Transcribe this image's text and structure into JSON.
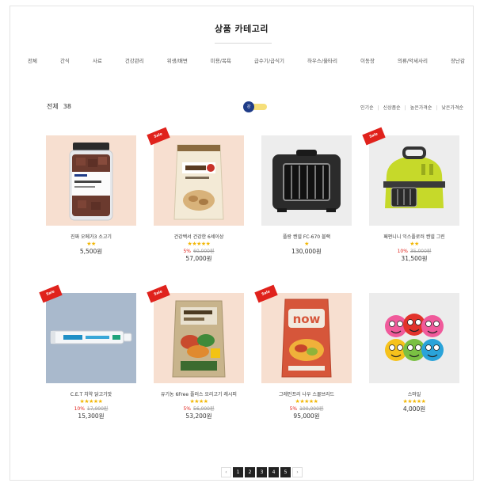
{
  "header": {
    "title": "상품 카테고리"
  },
  "categories": [
    "전체",
    "간식",
    "사료",
    "건강관리",
    "위생/배변",
    "미용/목욕",
    "급수기/급식기",
    "하우스/울타리",
    "이동장",
    "의류/악세사리",
    "장난감"
  ],
  "summary": {
    "label": "전체",
    "count": "38"
  },
  "toggle": {
    "label": "강"
  },
  "sort_options": [
    "인기순",
    "신상품순",
    "높은가격순",
    "낮은가격순"
  ],
  "sale_badge": "Sale",
  "products": [
    {
      "name": "진짜 오메가3 소고기",
      "stars": "★★",
      "discount": "",
      "original": "",
      "price": "5,500원"
    },
    {
      "name": "건강백서 건강한 6세이상",
      "stars": "★★★★★",
      "discount": "5%",
      "original": "60,000원",
      "price": "57,000원"
    },
    {
      "name": "플랑 켄넬 FC-670 블랙",
      "stars": "★",
      "discount": "",
      "original": "",
      "price": "130,000원"
    },
    {
      "name": "페펀니니 익스플로러 켄넬 그린",
      "stars": "★★",
      "discount": "10%",
      "original": "35,000원",
      "price": "31,500원"
    },
    {
      "name": "C.E.T 치약 닭고기맛",
      "stars": "★★★★★",
      "discount": "10%",
      "original": "17,000원",
      "price": "15,300원"
    },
    {
      "name": "유기농 6Free 플러스 오리고기 레시피",
      "stars": "★★★★",
      "discount": "5%",
      "original": "56,000원",
      "price": "53,200원"
    },
    {
      "name": "그레인프리 나우 스몰브리드",
      "stars": "★★★★★",
      "discount": "5%",
      "original": "100,000원",
      "price": "95,000원"
    },
    {
      "name": "스마일",
      "stars": "★★★★★",
      "discount": "",
      "original": "",
      "price": "4,000원"
    }
  ],
  "pagination": {
    "prev": "‹",
    "pages": [
      "1",
      "2",
      "3",
      "4",
      "5"
    ],
    "next": "›"
  },
  "colors": {
    "accent": "#1f3c88",
    "sale": "#e0221c",
    "star": "#f2b705",
    "toggle_track": "#f6df7a"
  }
}
